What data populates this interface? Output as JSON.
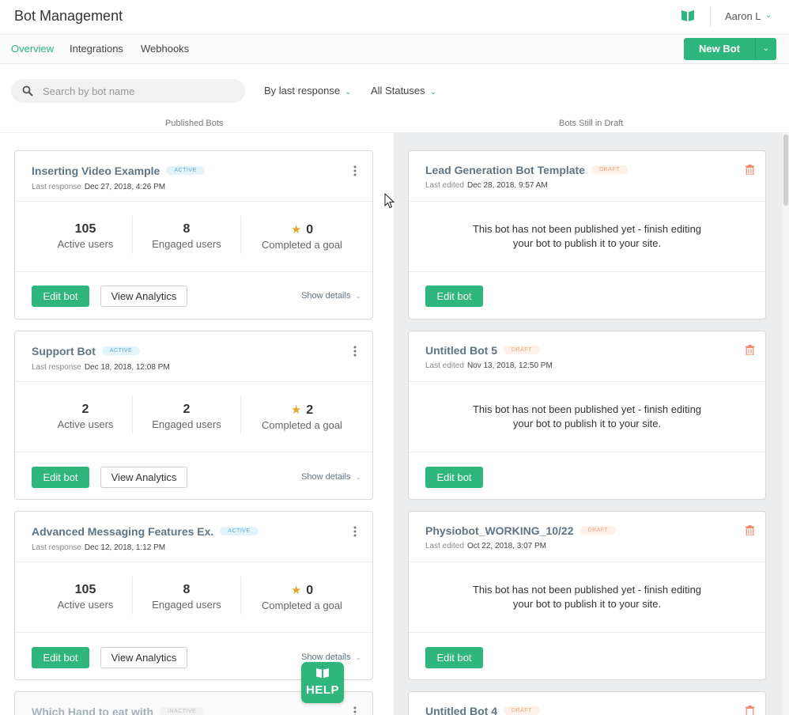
{
  "header": {
    "title": "Bot Management",
    "user": "Aaron L"
  },
  "tabs": [
    {
      "label": "Overview",
      "active": true
    },
    {
      "label": "Integrations",
      "active": false
    },
    {
      "label": "Webhooks",
      "active": false
    }
  ],
  "new_bot_label": "New Bot",
  "search": {
    "placeholder": "Search by bot name",
    "value": ""
  },
  "filters": {
    "sort": "By last response",
    "status": "All Statuses"
  },
  "columns": {
    "published": "Published Bots",
    "draft": "Bots Still in Draft"
  },
  "published_bots": [
    {
      "name": "Inserting Video Example",
      "status": "ACTIVE",
      "meta_label": "Last response",
      "meta_value": "Dec 27, 2018, 4:26 PM",
      "active_users": "105",
      "engaged_users": "8",
      "completed": "0"
    },
    {
      "name": "Support Bot",
      "status": "ACTIVE",
      "meta_label": "Last response",
      "meta_value": "Dec 18, 2018, 12:08 PM",
      "active_users": "2",
      "engaged_users": "2",
      "completed": "2"
    },
    {
      "name": "Advanced Messaging Features Ex.",
      "status": "ACTIVE",
      "meta_label": "Last response",
      "meta_value": "Dec 12, 2018, 1:12 PM",
      "active_users": "105",
      "engaged_users": "8",
      "completed": "0"
    },
    {
      "name": "Which Hand to eat with",
      "status": "INACTIVE"
    }
  ],
  "stat_labels": {
    "active": "Active users",
    "engaged": "Engaged users",
    "completed": "Completed a goal"
  },
  "buttons": {
    "edit": "Edit bot",
    "analytics": "View Analytics",
    "show_details": "Show details"
  },
  "draft_bots": [
    {
      "name": "Lead Generation Bot Template",
      "status": "DRAFT",
      "meta_label": "Last edited",
      "meta_value": "Dec 28, 2018, 9:57 AM"
    },
    {
      "name": "Untitled Bot 5",
      "status": "DRAFT",
      "meta_label": "Last edited",
      "meta_value": "Nov 13, 2018, 12:50 PM"
    },
    {
      "name": "Physiobot_WORKING_10/22",
      "status": "DRAFT",
      "meta_label": "Last edited",
      "meta_value": "Oct 22, 2018, 3:07 PM"
    },
    {
      "name": "Untitled Bot 4",
      "status": "DRAFT"
    }
  ],
  "draft_message_line1": "This bot has not been published yet - finish editing",
  "draft_message_line2": "your bot to publish it to your site.",
  "help_label": "HELP",
  "colors": {
    "accent": "#2eb67d",
    "title_slate": "#5f7486",
    "draft_badge": "#f0a27c",
    "active_badge": "#55aadd",
    "star": "#e5a532"
  }
}
